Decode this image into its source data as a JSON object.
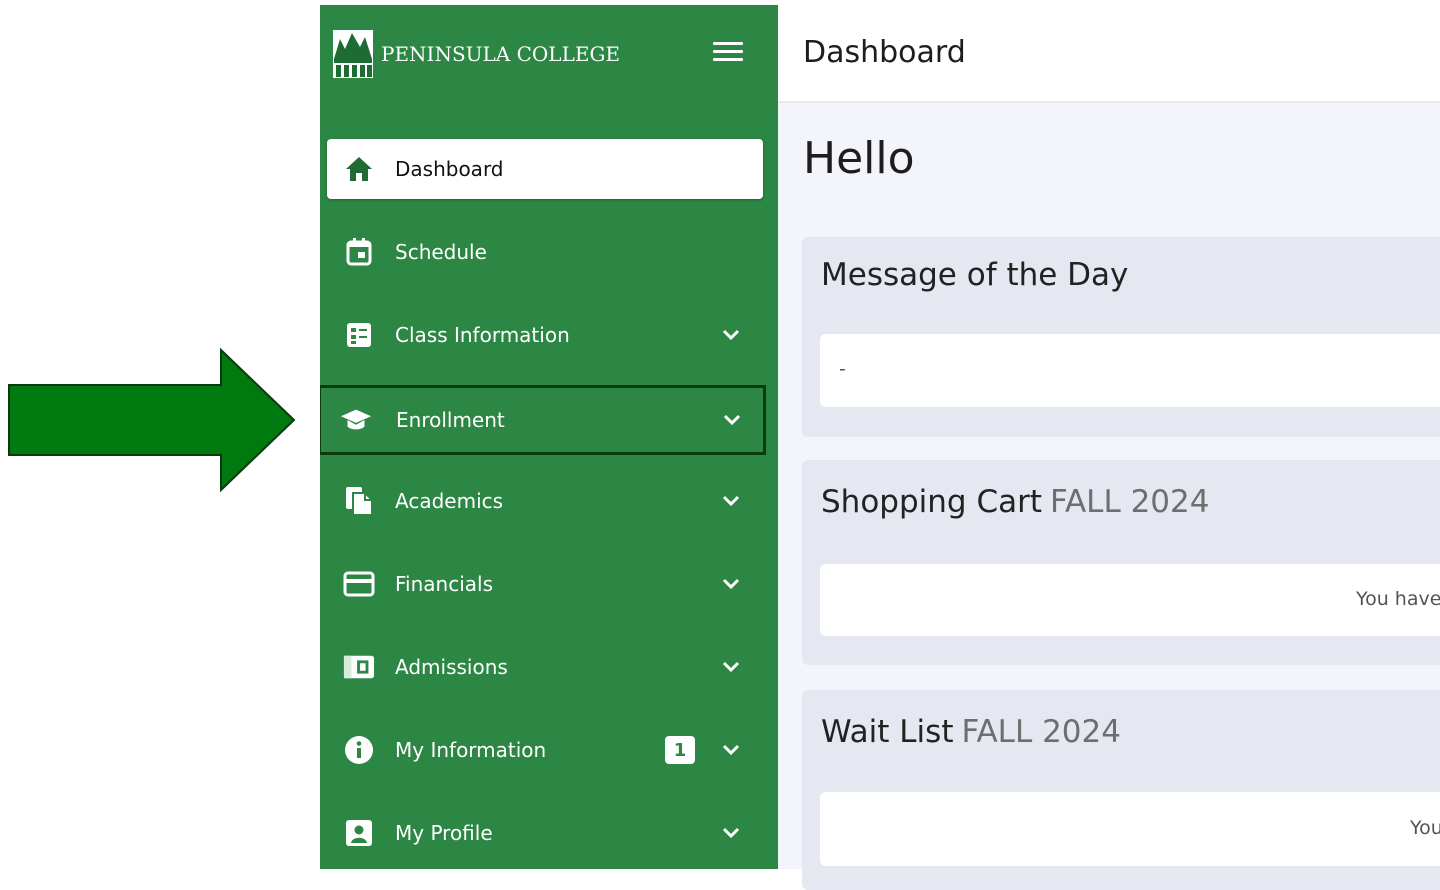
{
  "sidebar": {
    "brand_name": "PENINSULA COLLEGE",
    "items": [
      {
        "label": "Dashboard",
        "icon": "home-icon",
        "active": true
      },
      {
        "label": "Schedule",
        "icon": "calendar-icon"
      },
      {
        "label": "Class Information",
        "icon": "class-list-icon"
      },
      {
        "label": "Enrollment",
        "icon": "graduation-cap-icon"
      },
      {
        "label": "Academics",
        "icon": "documents-icon"
      },
      {
        "label": "Financials",
        "icon": "credit-card-icon"
      },
      {
        "label": "Admissions",
        "icon": "id-card-icon"
      },
      {
        "label": "My Information",
        "icon": "info-icon",
        "badge": "1"
      },
      {
        "label": "My Profile",
        "icon": "profile-icon"
      }
    ]
  },
  "header": {
    "title": "Dashboard"
  },
  "main": {
    "greeting": "Hello",
    "message_of_day": {
      "title": "Message of the Day",
      "content": "-"
    },
    "shopping_cart": {
      "title": "Shopping Cart",
      "term": "FALL 2024",
      "content": "You have"
    },
    "wait_list": {
      "title": "Wait List",
      "term": "FALL 2024",
      "content": "You"
    }
  },
  "colors": {
    "sidebar_green": "#2c8644",
    "arrow_green": "#007a0f",
    "highlight_border": "#0b3a10",
    "page_bg": "#f4f5fa",
    "card_bg": "#e6e8f1"
  }
}
